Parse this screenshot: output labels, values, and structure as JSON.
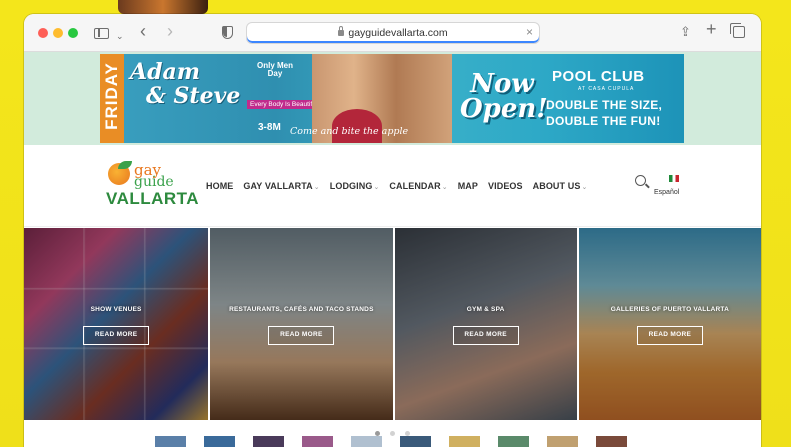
{
  "browser": {
    "url": "gayguidevallarta.com"
  },
  "banner": {
    "day": "FRIDAY",
    "name_line1": "Adam",
    "name_line2": "& Steve",
    "only_men": "Only Men Day",
    "everybody": "Every Body Is Beautiful",
    "time": "3-8M",
    "tagline": "Come and bite the apple",
    "now_open": "Now Open!",
    "pool_club": "POOL CLUB",
    "casa": "AT CASA CUPULA",
    "double1": "DOUBLE THE SIZE,",
    "double2": "DOUBLE THE FUN!"
  },
  "logo": {
    "gay": "gay",
    "guide": "guide",
    "vallarta": "VALLARTA"
  },
  "nav": {
    "items": [
      {
        "label": "HOME",
        "dropdown": false
      },
      {
        "label": "GAY VALLARTA",
        "dropdown": true
      },
      {
        "label": "LODGING",
        "dropdown": true
      },
      {
        "label": "CALENDAR",
        "dropdown": true
      },
      {
        "label": "MAP",
        "dropdown": false
      },
      {
        "label": "VIDEOS",
        "dropdown": false
      },
      {
        "label": "ABOUT US",
        "dropdown": true
      }
    ],
    "language": "Español",
    "caret": "⌄"
  },
  "slides": [
    {
      "title": "SHOW VENUES",
      "button": "READ MORE"
    },
    {
      "title": "RESTAURANTS, CAFÉS AND TACO STANDS",
      "button": "READ MORE"
    },
    {
      "title": "GYM & SPA",
      "button": "READ MORE"
    },
    {
      "title": "GALLERIES OF PUERTO VALLARTA",
      "button": "READ MORE"
    }
  ],
  "slider_pagination": {
    "total": 3,
    "active": 1
  },
  "thumbnails": [
    {
      "color": "#5a7fa8"
    },
    {
      "color": "#3a6a9a"
    },
    {
      "color": "#4a3a5a"
    },
    {
      "color": "#9a5a8a"
    },
    {
      "color": "#b0c0d0"
    },
    {
      "color": "#3a5a7a"
    },
    {
      "color": "#d0b060"
    },
    {
      "color": "#5a8a6a"
    },
    {
      "color": "#c0a070"
    },
    {
      "color": "#7a4a3a"
    }
  ],
  "icons": {
    "back": "‹",
    "forward": "›",
    "clear": "×",
    "share": "⇪",
    "new_tab": "+",
    "sidebar_chevron": "⌄"
  }
}
